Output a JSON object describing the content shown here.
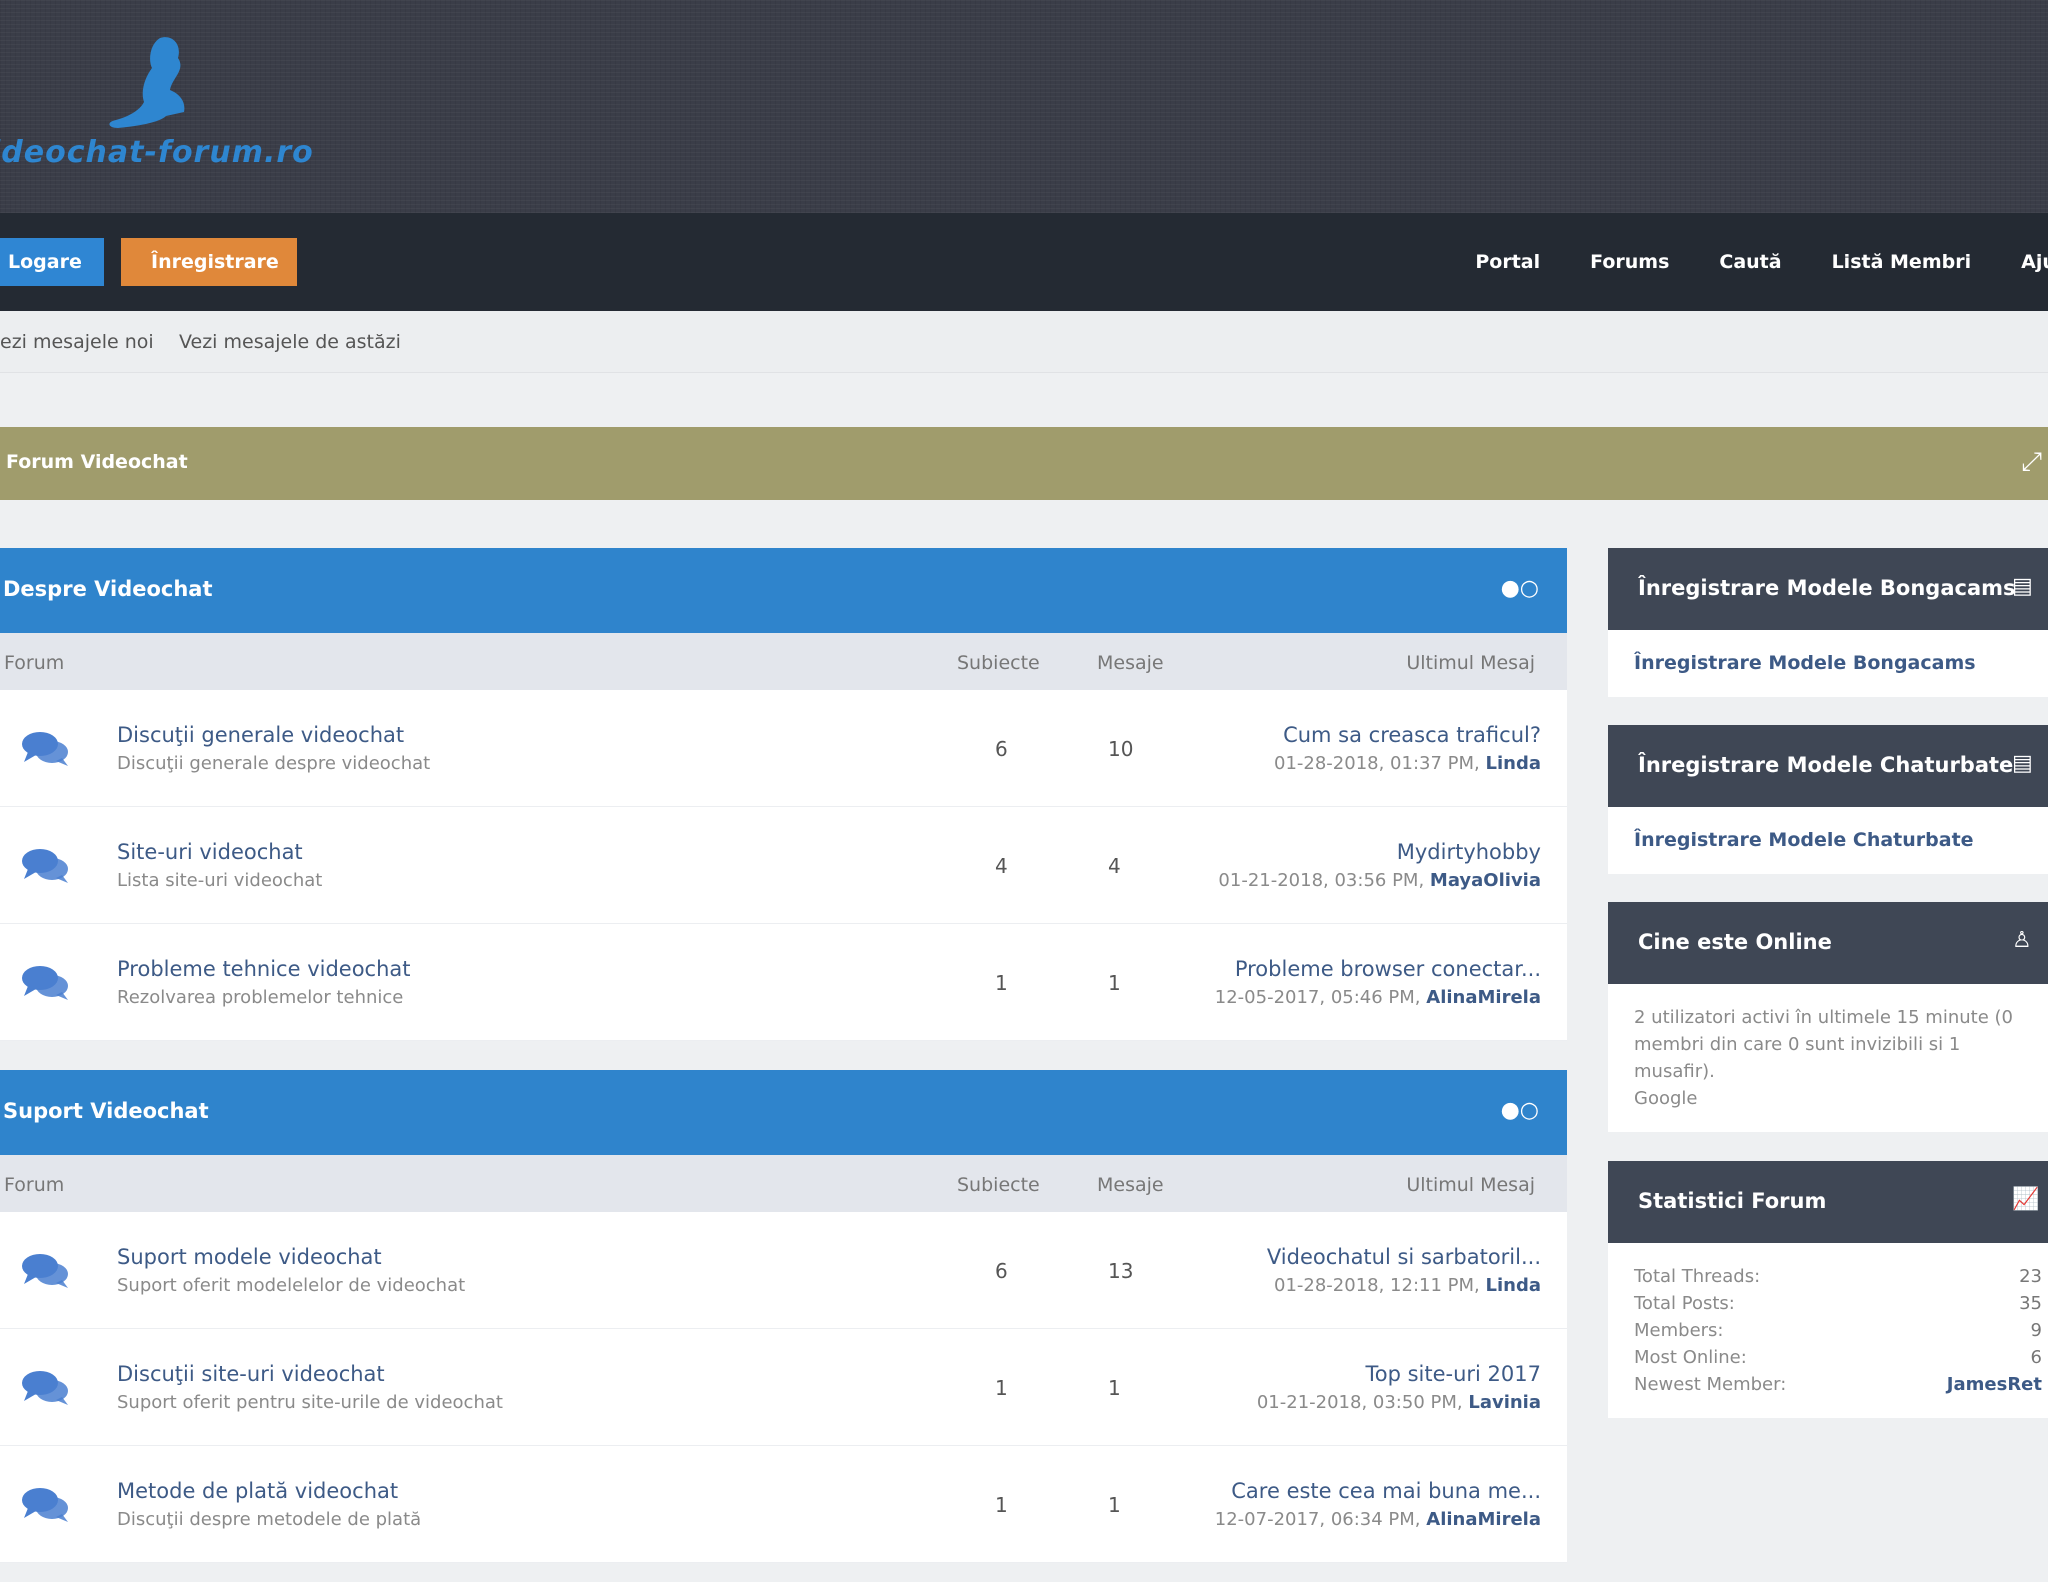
{
  "header": {
    "logo_text": "ideochat-forum.ro"
  },
  "nav": {
    "login": "Logare",
    "register": "Înregistrare",
    "links": [
      "Portal",
      "Forums",
      "Caută",
      "Listă Membri",
      "Ajuto"
    ]
  },
  "subnav": {
    "new_posts": "ezi mesajele noi",
    "today_posts": "Vezi mesajele de astăzi"
  },
  "banner": {
    "title": "Forum Videochat",
    "icon": "expand-collapse-icon"
  },
  "columns": {
    "forum": "Forum",
    "threads": "Subiecte",
    "posts": "Mesaje",
    "last": "Ultimul Mesaj"
  },
  "categories": [
    {
      "title": "Despre Videochat",
      "forums": [
        {
          "name": "Discuţii generale videochat",
          "desc": "Discuţii generale despre videochat",
          "threads": "6",
          "posts": "10",
          "last_title": "Cum sa creasca traficul?",
          "last_date": "01-28-2018, 01:37 PM,",
          "last_user": "Linda"
        },
        {
          "name": "Site-uri videochat",
          "desc": "Lista site-uri videochat",
          "threads": "4",
          "posts": "4",
          "last_title": "Mydirtyhobby",
          "last_date": "01-21-2018, 03:56 PM,",
          "last_user": "MayaOlivia"
        },
        {
          "name": "Probleme tehnice videochat",
          "desc": "Rezolvarea problemelor tehnice",
          "threads": "1",
          "posts": "1",
          "last_title": "Probleme browser conectar...",
          "last_date": "12-05-2017, 05:46 PM,",
          "last_user": "AlinaMirela"
        }
      ]
    },
    {
      "title": "Suport Videochat",
      "forums": [
        {
          "name": "Suport modele videochat",
          "desc": "Suport oferit modelelelor de videochat",
          "threads": "6",
          "posts": "13",
          "last_title": "Videochatul si sarbatoril...",
          "last_date": "01-28-2018, 12:11 PM,",
          "last_user": "Linda"
        },
        {
          "name": "Discuţii site-uri videochat",
          "desc": "Suport oferit pentru site-urile de videochat",
          "threads": "1",
          "posts": "1",
          "last_title": "Top site-uri 2017",
          "last_date": "01-21-2018, 03:50 PM,",
          "last_user": "Lavinia"
        },
        {
          "name": "Metode de plată videochat",
          "desc": "Discuţii despre metodele de plată",
          "threads": "1",
          "posts": "1",
          "last_title": "Care este cea mai buna me...",
          "last_date": "12-07-2017, 06:34 PM,",
          "last_user": "AlinaMirela"
        }
      ]
    }
  ],
  "sidebar": {
    "bongacams": {
      "title": "Înregistrare Modele Bongacams",
      "link": "Înregistrare Modele Bongacams"
    },
    "chaturbate": {
      "title": "Înregistrare Modele Chaturbate",
      "link": "Înregistrare Modele Chaturbate"
    },
    "online": {
      "title": "Cine este Online",
      "text": "2 utilizatori activi în ultimele 15 minute (0 membri din care 0 sunt invizibili si 1 musafir).",
      "bot": "Google"
    },
    "stats": {
      "title": "Statistici Forum",
      "rows": [
        {
          "label": "Total Threads:",
          "value": "23"
        },
        {
          "label": "Total Posts:",
          "value": "35"
        },
        {
          "label": "Members:",
          "value": "9"
        },
        {
          "label": "Most Online:",
          "value": "6"
        },
        {
          "label": "Newest Member:",
          "value": "JamesRet"
        }
      ]
    }
  },
  "colors": {
    "category_header": "#2f84cc",
    "banner": "#a09c6c",
    "sidebar_header": "#3f4755",
    "login_button": "#2f86d3",
    "register_button": "#e0883a"
  }
}
